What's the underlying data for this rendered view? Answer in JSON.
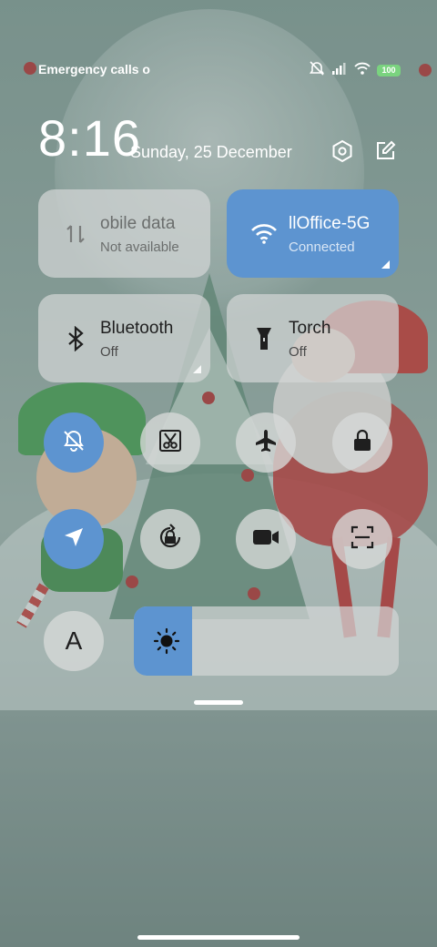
{
  "status_bar": {
    "carrier_text": "Emergency calls o",
    "battery": "100",
    "icons": [
      "muted-alarm-icon",
      "signal-icon",
      "wifi-icon",
      "battery-icon"
    ]
  },
  "header": {
    "time": "8:16",
    "date": "Sunday, 25 December",
    "settings_icon": "gear-icon",
    "edit_icon": "edit-icon"
  },
  "tiles": {
    "mobile_data": {
      "label": "obile data",
      "sub": "Not available",
      "icon": "mobile-data-icon"
    },
    "wifi": {
      "label": "llOffice-5G",
      "sub": "Connected",
      "icon": "wifi-icon"
    },
    "bluetooth": {
      "label": "Bluetooth",
      "sub": "Off",
      "icon": "bluetooth-icon"
    },
    "torch": {
      "label": "Torch",
      "sub": "Off",
      "icon": "torch-icon"
    }
  },
  "toggles_row1": [
    {
      "name": "silent-mode",
      "icon": "bell-off-icon",
      "active": true
    },
    {
      "name": "screenshot",
      "icon": "scissors-icon",
      "active": false
    },
    {
      "name": "airplane-mode",
      "icon": "airplane-icon",
      "active": false
    },
    {
      "name": "lock-screen",
      "icon": "lock-icon",
      "active": false
    }
  ],
  "toggles_row2": [
    {
      "name": "location",
      "icon": "navigation-icon",
      "active": true
    },
    {
      "name": "auto-rotate",
      "icon": "rotate-lock-icon",
      "active": false
    },
    {
      "name": "screen-recorder",
      "icon": "video-camera-icon",
      "active": false
    },
    {
      "name": "scanner",
      "icon": "scan-icon",
      "active": false
    }
  ],
  "reading_mode": {
    "label": "A",
    "icon": "font-icon"
  },
  "brightness": {
    "level": 0.22,
    "icon": "sun-icon"
  },
  "colors": {
    "accent": "#5d94d0",
    "tile_bg": "#d2d6d5"
  }
}
